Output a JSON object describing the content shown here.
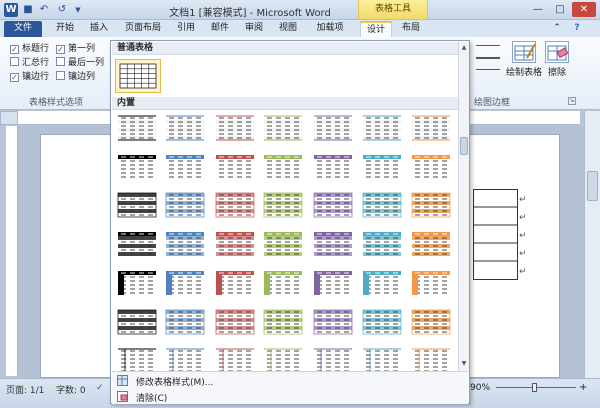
{
  "window": {
    "title": "文档1 [兼容模式] - Microsoft Word",
    "tools_header": "表格工具",
    "app_icon": "W"
  },
  "tabs": [
    {
      "label": "文件"
    },
    {
      "label": "开始"
    },
    {
      "label": "插入"
    },
    {
      "label": "页面布局"
    },
    {
      "label": "引用"
    },
    {
      "label": "邮件"
    },
    {
      "label": "审阅"
    },
    {
      "label": "视图"
    },
    {
      "label": "加载项"
    },
    {
      "label": "设计"
    },
    {
      "label": "布局"
    }
  ],
  "style_options": {
    "group_label": "表格样式选项",
    "checkboxes": [
      {
        "label": "标题行",
        "checked": true
      },
      {
        "label": "第一列",
        "checked": true
      },
      {
        "label": "汇总行",
        "checked": false
      },
      {
        "label": "最后一列",
        "checked": false
      },
      {
        "label": "镶边行",
        "checked": true
      },
      {
        "label": "镶边列",
        "checked": false
      }
    ]
  },
  "borders_group": {
    "group_label": "绘图边框",
    "draw_table": "绘制表格",
    "eraser": "擦除"
  },
  "gallery": {
    "section_plain": "普通表格",
    "section_builtin": "内置",
    "palette": [
      "#444444",
      "#8fb3d9",
      "#d98f8f",
      "#b5cf7f",
      "#b09ad0",
      "#7fc6d6",
      "#f0a860"
    ],
    "palette_strong": [
      "#000000",
      "#4f81bd",
      "#c0504d",
      "#9bbb59",
      "#8064a2",
      "#4bacc6",
      "#f79646"
    ],
    "menu": [
      {
        "label": "修改表格样式(M)...",
        "icon": "modify-table-style-icon"
      },
      {
        "label": "清除(C)",
        "icon": "clear-style-icon"
      }
    ]
  },
  "status": {
    "page": "页面: 1/1",
    "words": "字数: 0",
    "zoom": "90%"
  }
}
